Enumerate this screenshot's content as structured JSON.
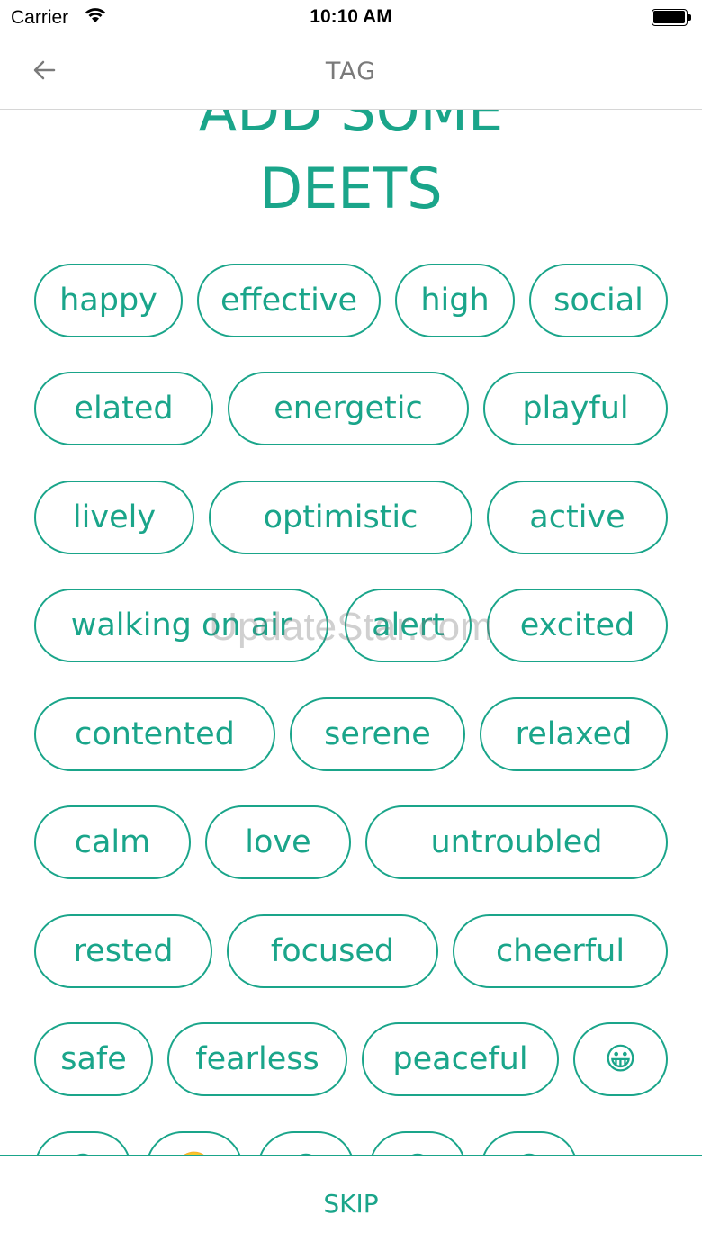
{
  "status_bar": {
    "carrier": "Carrier",
    "time": "10:10 AM"
  },
  "nav": {
    "title": "TAG"
  },
  "heading": {
    "line1": "ADD SOME",
    "line2": "DEETS"
  },
  "tags": [
    "happy",
    "effective",
    "high",
    "social",
    "elated",
    "energetic",
    "playful",
    "lively",
    "optimistic",
    "active",
    "walking on air",
    "alert",
    "excited",
    "contented",
    "serene",
    "relaxed",
    "calm",
    "love",
    "untroubled",
    "rested",
    "focused",
    "cheerful",
    "safe",
    "fearless",
    "peaceful",
    "😀",
    "😊",
    "🙂",
    "😌",
    "😄",
    "😃"
  ],
  "watermark": "UpdateStar.com",
  "footer": {
    "skip_label": "SKIP"
  },
  "colors": {
    "accent": "#1aa58a",
    "nav_title": "#7a7a7a"
  },
  "icons": {
    "back": "arrow-left-icon",
    "wifi": "wifi-icon",
    "battery": "battery-icon"
  }
}
